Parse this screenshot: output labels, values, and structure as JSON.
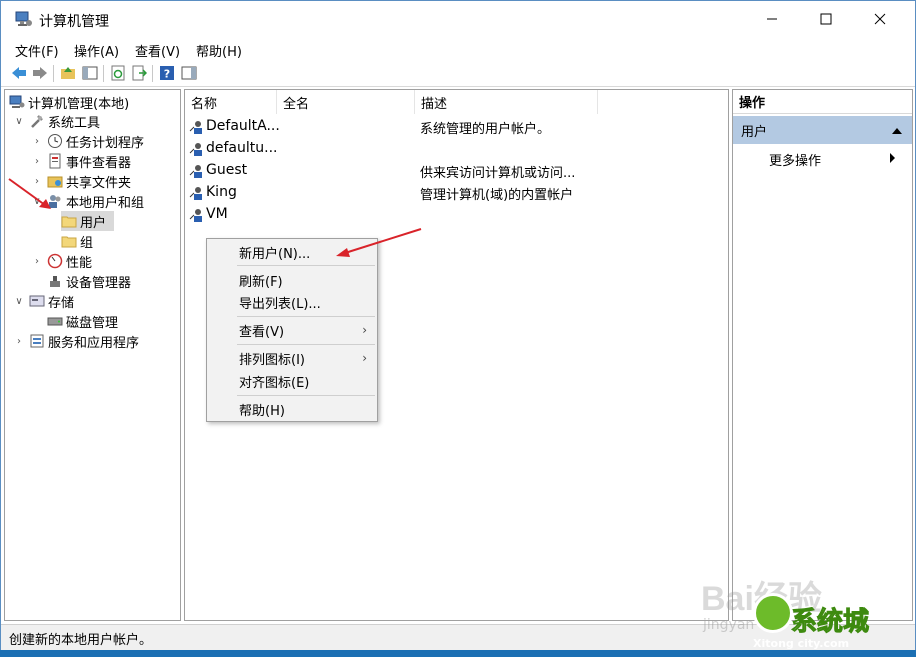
{
  "window": {
    "title": "计算机管理",
    "controls": {
      "minimize": "—",
      "maximize": "☐",
      "close": "✕"
    }
  },
  "menubar": [
    "文件(F)",
    "操作(A)",
    "查看(V)",
    "帮助(H)"
  ],
  "toolbar": {
    "icons": [
      "back-icon",
      "forward-icon",
      "up-folder-icon",
      "show-hide-tree-icon",
      "refresh-icon",
      "export-list-icon",
      "help-icon",
      "show-hide-action-pane-icon"
    ]
  },
  "tree": {
    "root": "计算机管理(本地)",
    "items": [
      {
        "label": "系统工具",
        "level": 1,
        "expander": "∨"
      },
      {
        "label": "任务计划程序",
        "level": 2,
        "expander": "›"
      },
      {
        "label": "事件查看器",
        "level": 2,
        "expander": "›"
      },
      {
        "label": "共享文件夹",
        "level": 2,
        "expander": "›"
      },
      {
        "label": "本地用户和组",
        "level": 2,
        "expander": "∨"
      },
      {
        "label": "用户",
        "level": 3,
        "expander": "",
        "selected": true
      },
      {
        "label": "组",
        "level": 3,
        "expander": ""
      },
      {
        "label": "性能",
        "level": 2,
        "expander": "›"
      },
      {
        "label": "设备管理器",
        "level": 2,
        "expander": ""
      },
      {
        "label": "存储",
        "level": 1,
        "expander": "∨"
      },
      {
        "label": "磁盘管理",
        "level": 2,
        "expander": ""
      },
      {
        "label": "服务和应用程序",
        "level": 1,
        "expander": "›"
      }
    ]
  },
  "list": {
    "columns": [
      "名称",
      "全名",
      "描述"
    ],
    "rows": [
      {
        "name": "DefaultA...",
        "fullname": "",
        "description": "系统管理的用户帐户。"
      },
      {
        "name": "defaultu...",
        "fullname": "",
        "description": ""
      },
      {
        "name": "Guest",
        "fullname": "",
        "description": "供来宾访问计算机或访问..."
      },
      {
        "name": "King",
        "fullname": "",
        "description": "管理计算机(域)的内置帐户"
      },
      {
        "name": "VM",
        "fullname": "",
        "description": ""
      }
    ]
  },
  "actions": {
    "header": "操作",
    "section": "用户",
    "items": [
      "更多操作"
    ]
  },
  "context_menu": {
    "items": [
      {
        "label": "新用户(N)...",
        "submenu": false
      },
      {
        "label": "刷新(F)",
        "submenu": false
      },
      {
        "label": "导出列表(L)...",
        "submenu": false
      },
      {
        "label": "查看(V)",
        "submenu": true
      },
      {
        "label": "排列图标(I)",
        "submenu": true
      },
      {
        "label": "对齐图标(E)",
        "submenu": false
      },
      {
        "label": "帮助(H)",
        "submenu": false
      }
    ]
  },
  "status": {
    "text": "创建新的本地用户帐户。"
  },
  "watermark": {
    "baidu": "Bai经验",
    "jingyan": "jingyan",
    "site_name": "系统城",
    "site_url": "Xitong city.com"
  },
  "colors": {
    "selection": "#d9d9d9",
    "action_section": "#b3c9e2",
    "annotation_arrow": "#d9232a",
    "desktop": "#1b6fb3"
  }
}
